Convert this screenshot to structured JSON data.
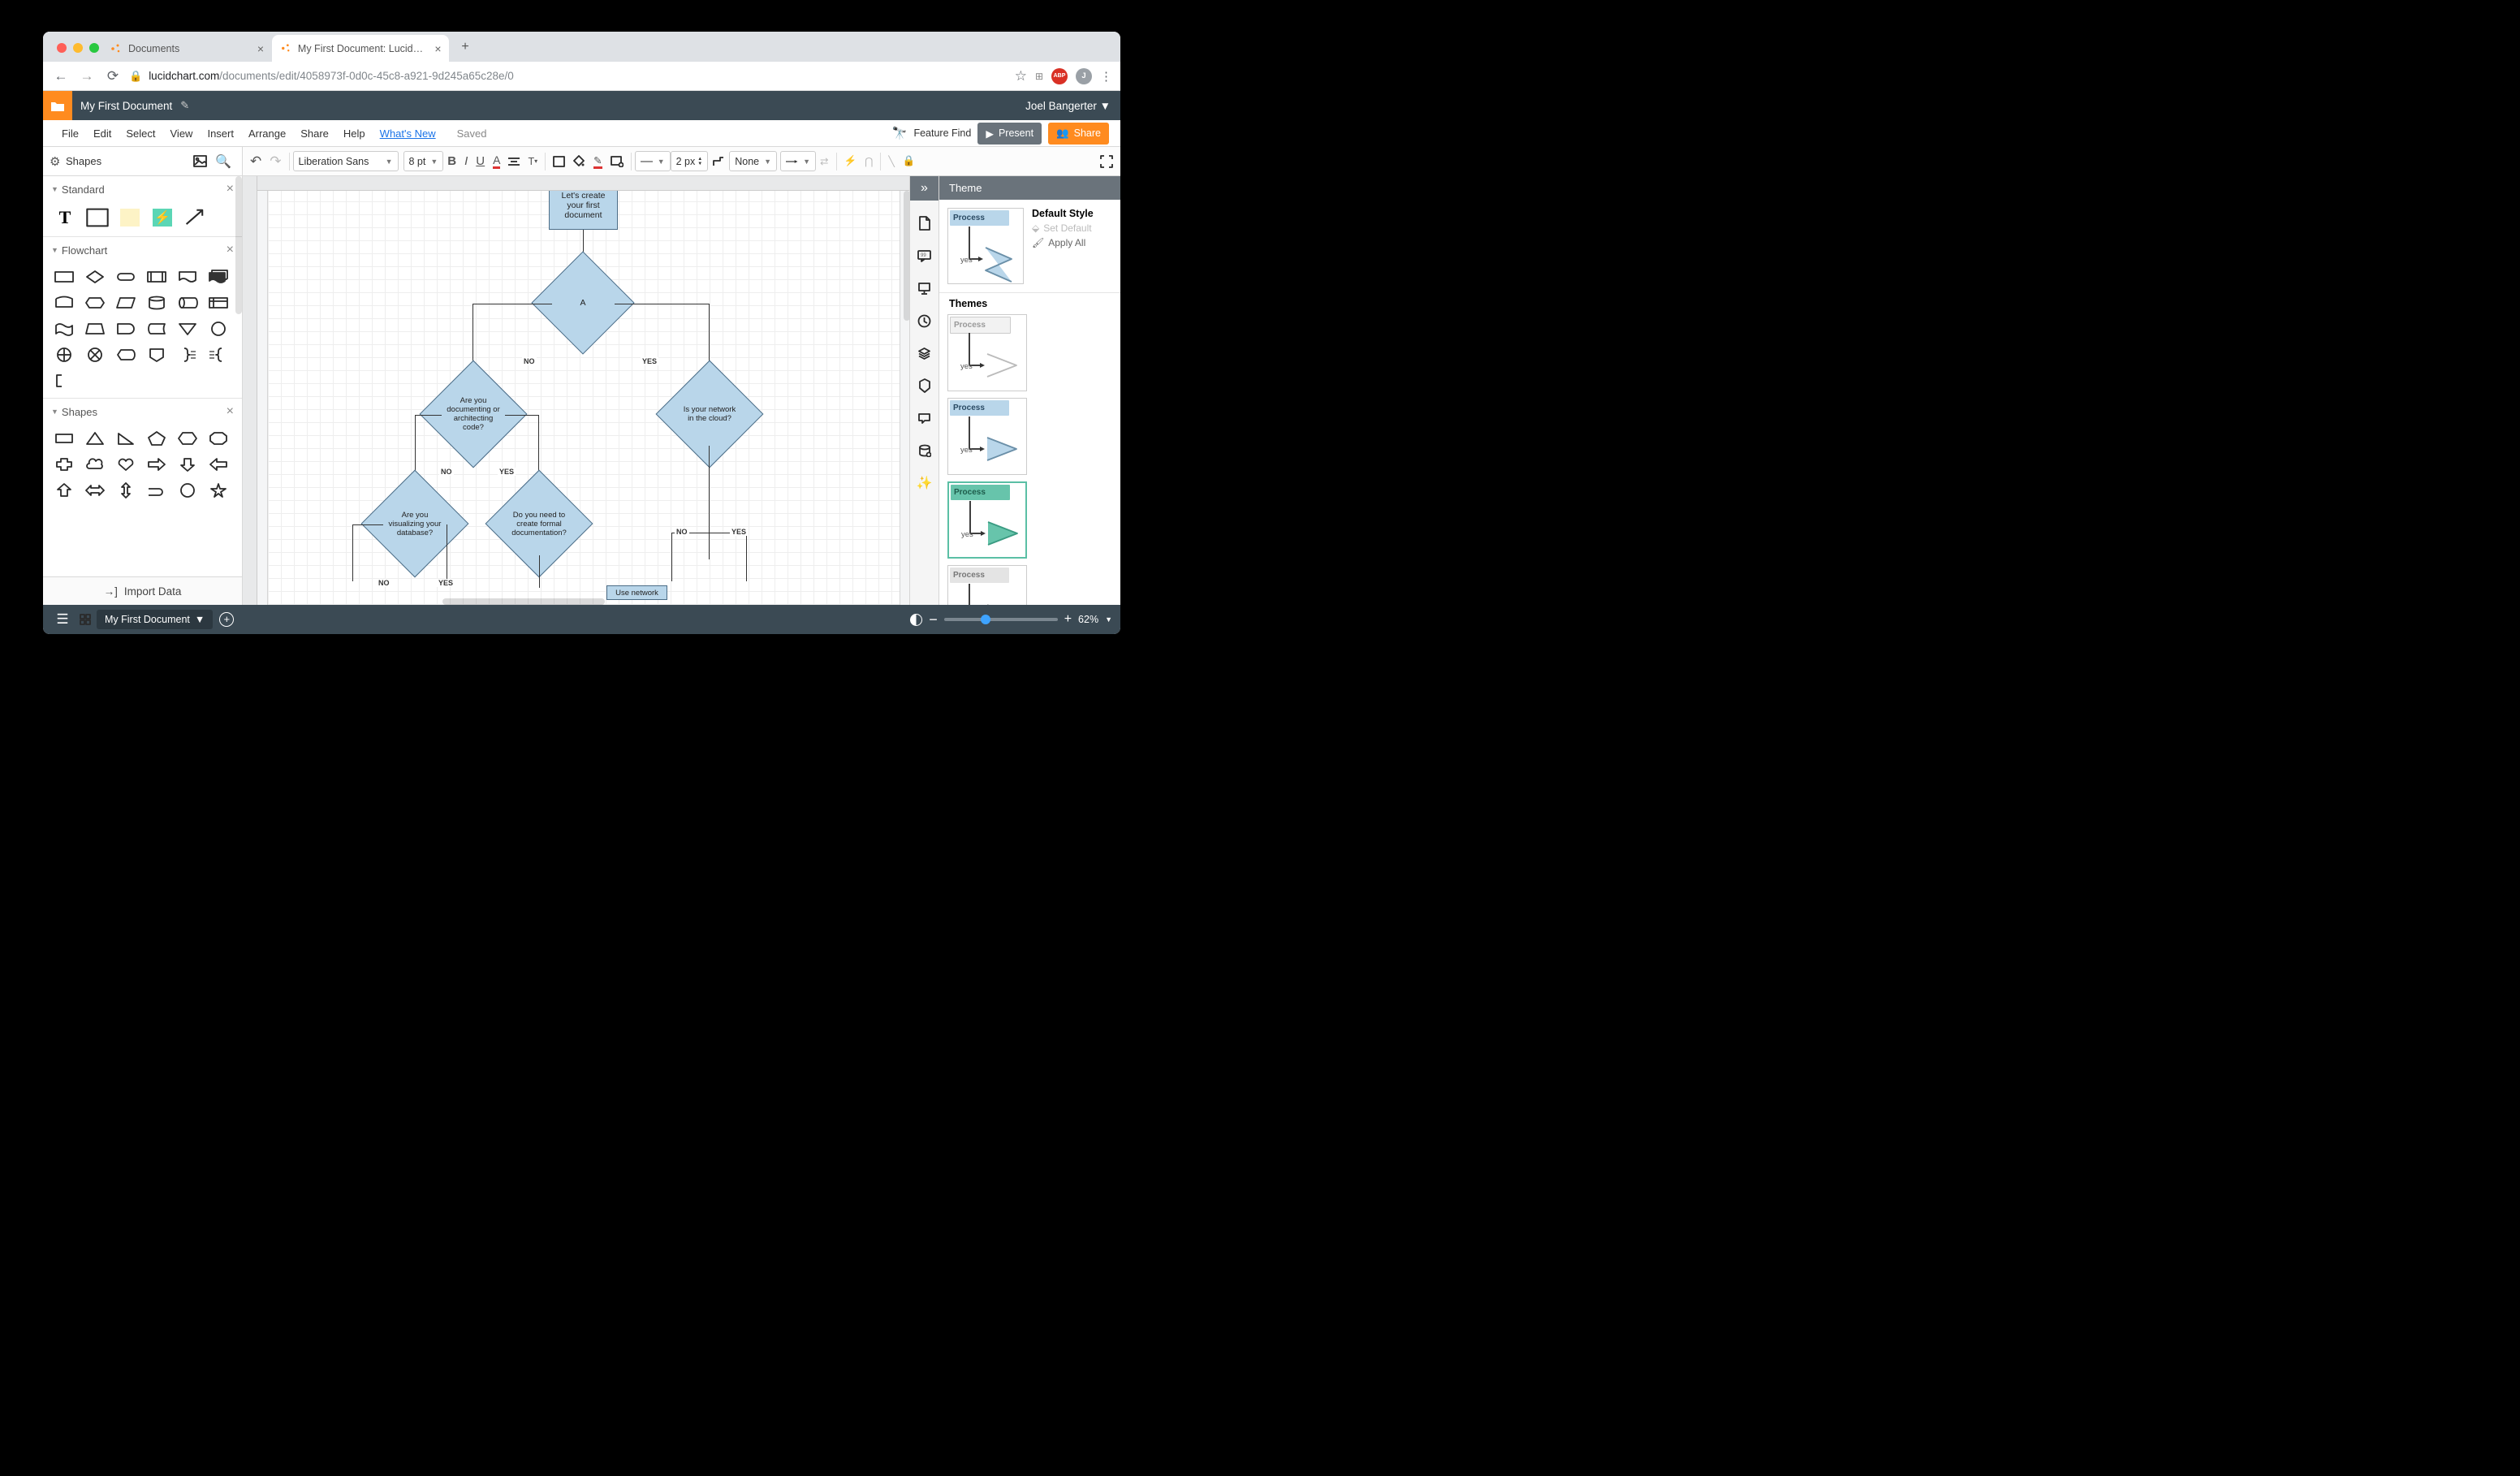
{
  "browser": {
    "traffic": {
      "close": "#ff5f57",
      "min": "#febb2e",
      "max": "#28c840"
    },
    "tabs": [
      {
        "title": "Documents",
        "active": false
      },
      {
        "title": "My First Document: Lucidchart",
        "active": true
      }
    ],
    "back_enabled": true,
    "url_host": "lucidchart.com",
    "url_path": "/documents/edit/4058973f-0d0c-45c8-a921-9d245a65c28e/0",
    "ext_abp": "ABP",
    "avatar_letter": "J"
  },
  "header": {
    "doc_title": "My First Document",
    "user": "Joel Bangerter"
  },
  "menu": {
    "items": [
      "File",
      "Edit",
      "Select",
      "View",
      "Insert",
      "Arrange",
      "Share",
      "Help"
    ],
    "whats_new": "What's New",
    "saved": "Saved",
    "feature_find": "Feature Find",
    "present": "Present",
    "share": "Share"
  },
  "toolbar": {
    "font": "Liberation Sans",
    "size": "8 pt",
    "stroke": "2 px",
    "fill_label": "None"
  },
  "shapes_header": {
    "label": "Shapes"
  },
  "shape_cats": {
    "standard": "Standard",
    "flowchart": "Flowchart",
    "shapes": "Shapes",
    "import": "Import Data"
  },
  "flow": {
    "start": "Let's create\nyour first\ndocument",
    "A": "A",
    "A_no": "NO",
    "A_yes": "YES",
    "doc_code": "Are you\ndocumenting or\narchitecting\ncode?",
    "net_cloud": "Is your network\nin the cloud?",
    "doc_no": "NO",
    "doc_yes": "YES",
    "viz_db": "Are you visualizing\nyour database?",
    "formal": "Do you need to\ncreate formal\ndocumentation?",
    "viz_no": "NO",
    "viz_yes": "YES",
    "net_no": "NO",
    "net_yes": "YES",
    "use_net": "Use network"
  },
  "theme": {
    "panel": "Theme",
    "default": "Default Style",
    "set_default": "Set Default",
    "apply_all": "Apply All",
    "themes_hdr": "Themes",
    "proc": "Process",
    "yes": "yes"
  },
  "status": {
    "doc": "My First Document",
    "zoom": "62%"
  }
}
